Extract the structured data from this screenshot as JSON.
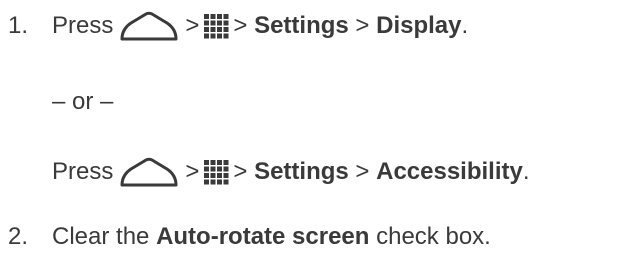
{
  "steps": [
    {
      "number": "1.",
      "press": "Press",
      "gt1": ">",
      "gt2": ">",
      "settings": "Settings",
      "gt3": ">",
      "target": "Display",
      "end": "."
    }
  ],
  "or_text": "– or –",
  "alt": {
    "press": "Press",
    "gt1": ">",
    "gt2": ">",
    "settings": "Settings",
    "gt3": ">",
    "target": "Accessibility",
    "end": "."
  },
  "step2": {
    "number": "2.",
    "before": "Clear the",
    "bold": "Auto-rotate screen",
    "after": "check box."
  },
  "icons": {
    "home": "home-icon",
    "apps": "apps-grid-icon",
    "icon_color": "#3a3a3a"
  }
}
